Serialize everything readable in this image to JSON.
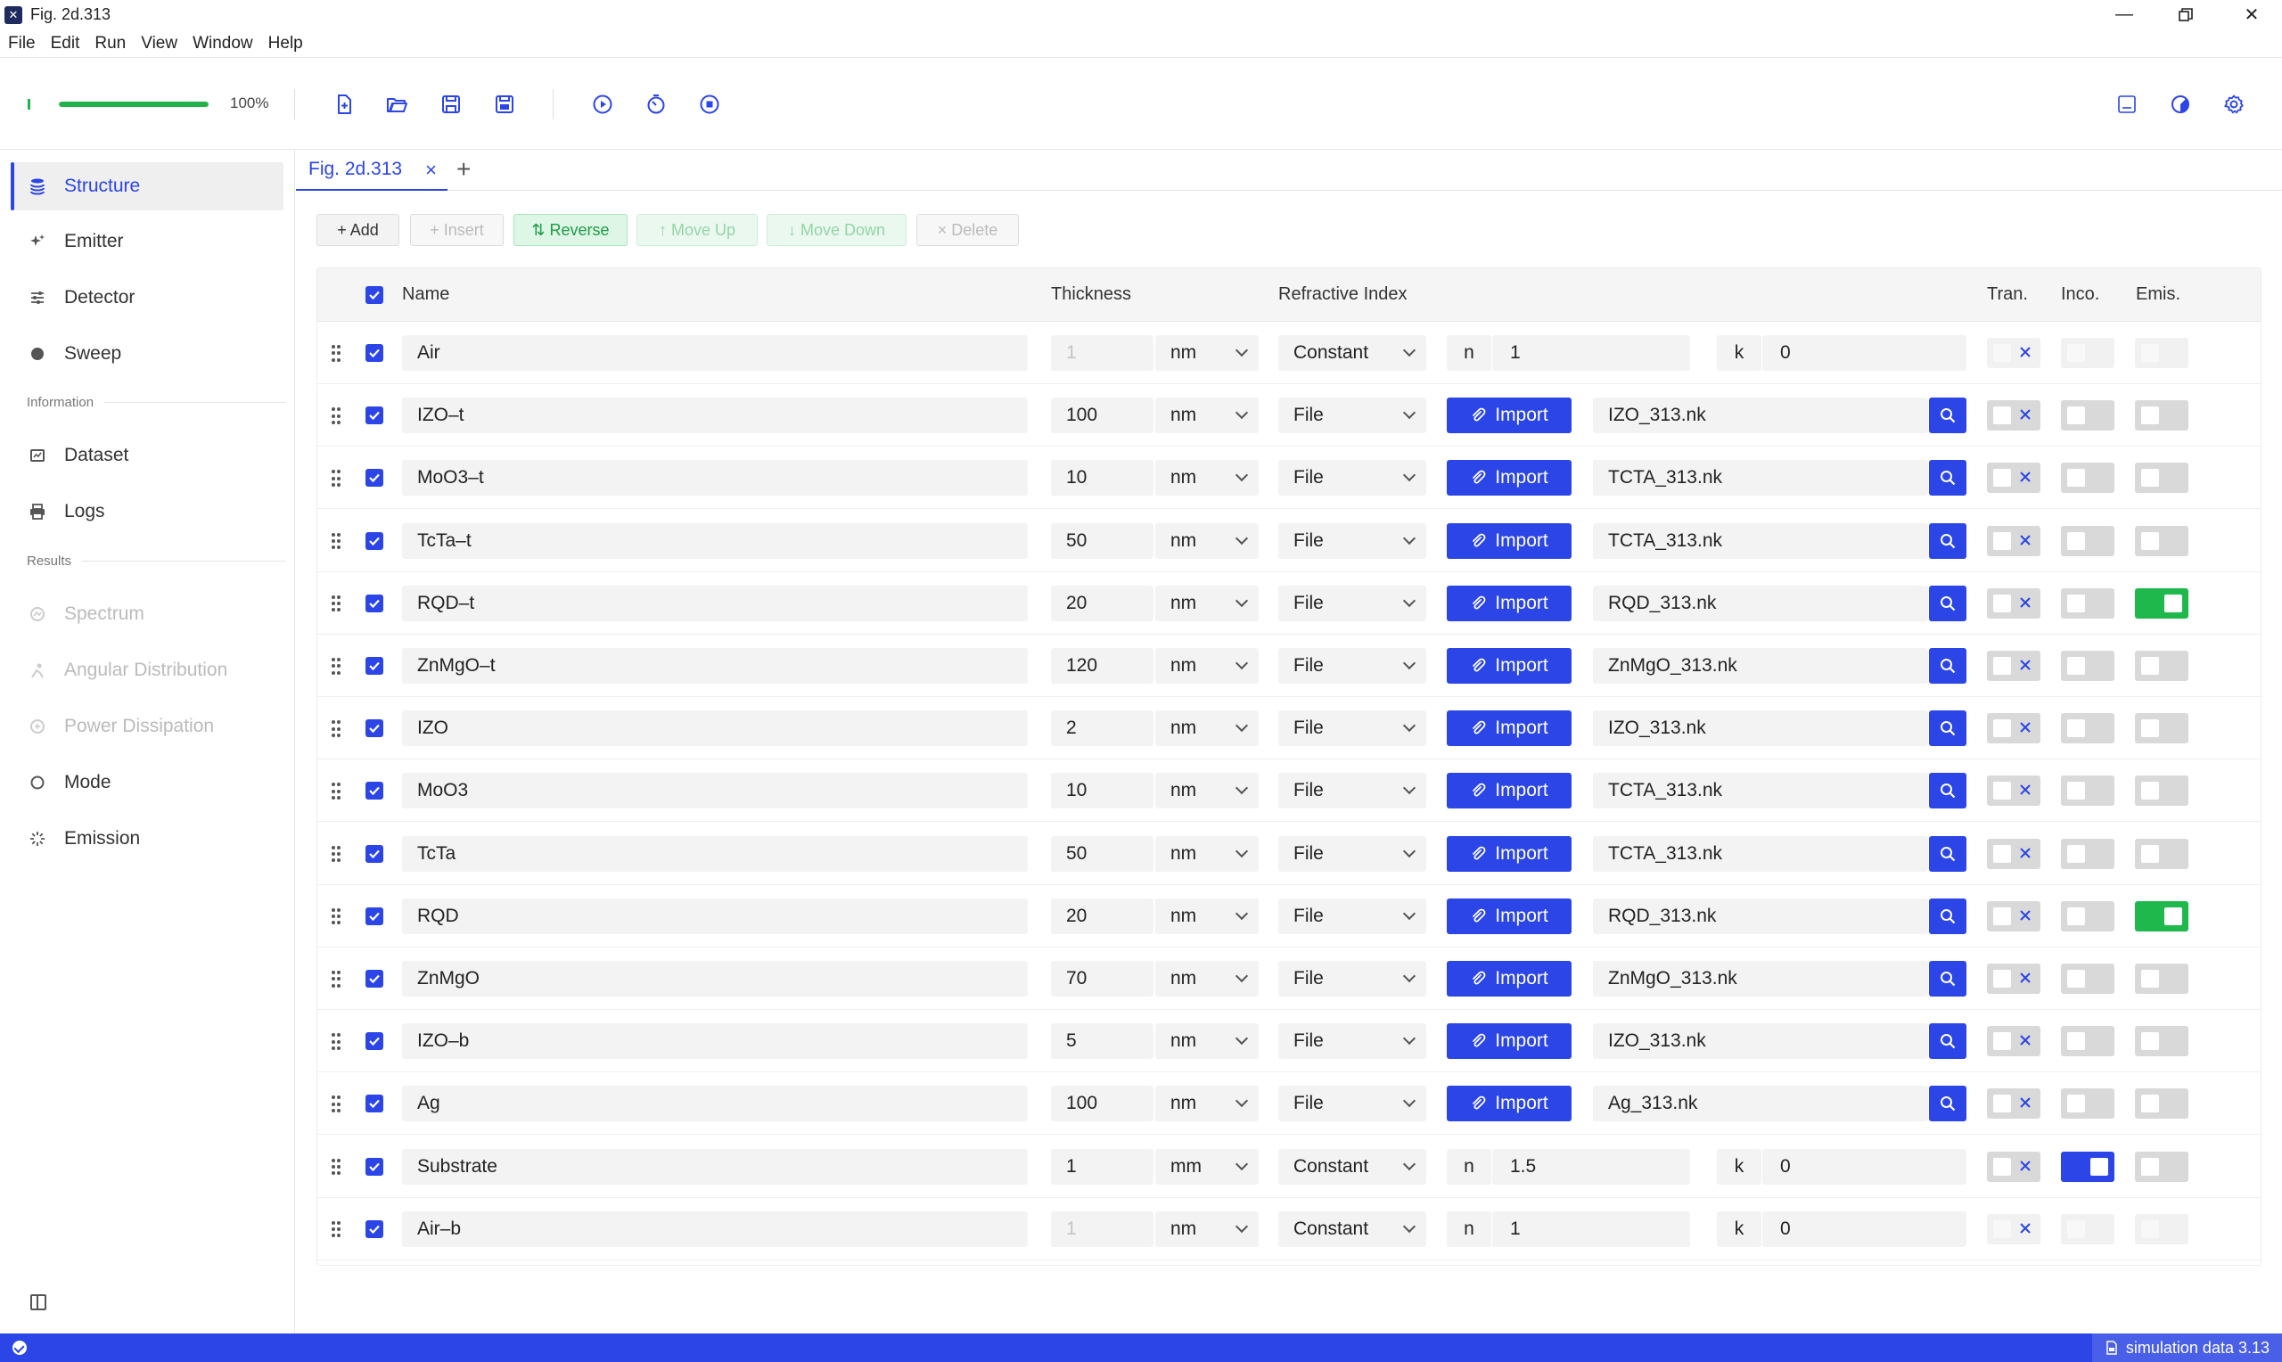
{
  "window": {
    "title": "Fig. 2d.313"
  },
  "menu": [
    "File",
    "Edit",
    "Run",
    "View",
    "Window",
    "Help"
  ],
  "progress": {
    "value": 1.0,
    "label": "100%"
  },
  "sidebar": {
    "items": [
      {
        "label": "Structure",
        "icon": "layers-icon",
        "state": "active"
      },
      {
        "label": "Emitter",
        "icon": "sparkle-icon",
        "state": "normal"
      },
      {
        "label": "Detector",
        "icon": "sliders-icon",
        "state": "normal"
      },
      {
        "label": "Sweep",
        "icon": "circle-icon",
        "state": "normal"
      }
    ],
    "section_information": "Information",
    "info_items": [
      {
        "label": "Dataset",
        "icon": "dataset-icon",
        "state": "normal"
      },
      {
        "label": "Logs",
        "icon": "printer-icon",
        "state": "normal"
      }
    ],
    "section_results": "Results",
    "result_items": [
      {
        "label": "Spectrum",
        "icon": "spectrum-icon",
        "state": "disabled"
      },
      {
        "label": "Angular Distribution",
        "icon": "angular-icon",
        "state": "disabled"
      },
      {
        "label": "Power Dissipation",
        "icon": "power-icon",
        "state": "disabled"
      },
      {
        "label": "Mode",
        "icon": "ring-icon",
        "state": "normal"
      },
      {
        "label": "Emission",
        "icon": "loader-icon",
        "state": "normal"
      }
    ]
  },
  "tab": {
    "label": "Fig. 2d.313",
    "close": "×",
    "add": "+"
  },
  "actions": {
    "add": "+ Add",
    "insert": "+ Insert",
    "reverse": "⇅ Reverse",
    "move_up": "↑ Move Up",
    "move_down": "↓ Move Down",
    "delete": "× Delete"
  },
  "table": {
    "headers": {
      "name": "Name",
      "thickness": "Thickness",
      "refractive_index": "Refractive Index",
      "tran": "Tran.",
      "inco": "Inco.",
      "emis": "Emis."
    },
    "rows": [
      {
        "name": "Air",
        "thickness": "1",
        "unit": "nm",
        "mode": "Constant",
        "n": "1",
        "k": "0",
        "faded": true,
        "tran": "dis",
        "inco": "dis",
        "emis": "dis"
      },
      {
        "name": "IZO–t",
        "thickness": "100",
        "unit": "nm",
        "mode": "File",
        "file": "IZO_313.nk",
        "tran": "off",
        "inco": "off",
        "emis": "off"
      },
      {
        "name": "MoO3–t",
        "thickness": "10",
        "unit": "nm",
        "mode": "File",
        "file": "TCTA_313.nk",
        "tran": "off",
        "inco": "off",
        "emis": "off"
      },
      {
        "name": "TcTa–t",
        "thickness": "50",
        "unit": "nm",
        "mode": "File",
        "file": "TCTA_313.nk",
        "tran": "off",
        "inco": "off",
        "emis": "off"
      },
      {
        "name": "RQD–t",
        "thickness": "20",
        "unit": "nm",
        "mode": "File",
        "file": "RQD_313.nk",
        "tran": "off",
        "inco": "off",
        "emis": "green"
      },
      {
        "name": "ZnMgO–t",
        "thickness": "120",
        "unit": "nm",
        "mode": "File",
        "file": "ZnMgO_313.nk",
        "tran": "off",
        "inco": "off",
        "emis": "off"
      },
      {
        "name": "IZO",
        "thickness": "2",
        "unit": "nm",
        "mode": "File",
        "file": "IZO_313.nk",
        "tran": "off",
        "inco": "off",
        "emis": "off"
      },
      {
        "name": "MoO3",
        "thickness": "10",
        "unit": "nm",
        "mode": "File",
        "file": "TCTA_313.nk",
        "tran": "off",
        "inco": "off",
        "emis": "off"
      },
      {
        "name": "TcTa",
        "thickness": "50",
        "unit": "nm",
        "mode": "File",
        "file": "TCTA_313.nk",
        "tran": "off",
        "inco": "off",
        "emis": "off"
      },
      {
        "name": "RQD",
        "thickness": "20",
        "unit": "nm",
        "mode": "File",
        "file": "RQD_313.nk",
        "tran": "off",
        "inco": "off",
        "emis": "green"
      },
      {
        "name": "ZnMgO",
        "thickness": "70",
        "unit": "nm",
        "mode": "File",
        "file": "ZnMgO_313.nk",
        "tran": "off",
        "inco": "off",
        "emis": "off"
      },
      {
        "name": "IZO–b",
        "thickness": "5",
        "unit": "nm",
        "mode": "File",
        "file": "IZO_313.nk",
        "tran": "off",
        "inco": "off",
        "emis": "off"
      },
      {
        "name": "Ag",
        "thickness": "100",
        "unit": "nm",
        "mode": "File",
        "file": "Ag_313.nk",
        "tran": "off",
        "inco": "off",
        "emis": "off"
      },
      {
        "name": "Substrate",
        "thickness": "1",
        "unit": "mm",
        "mode": "Constant",
        "n": "1.5",
        "k": "0",
        "tran": "off",
        "inco": "blue",
        "emis": "off"
      },
      {
        "name": "Air–b",
        "thickness": "1",
        "unit": "nm",
        "mode": "Constant",
        "n": "1",
        "k": "0",
        "faded": true,
        "tran": "dis",
        "inco": "dis",
        "emis": "dis"
      }
    ],
    "import_label": "Import",
    "n_label": "n",
    "k_label": "k"
  },
  "status": {
    "right": "simulation data 3.13"
  },
  "colors": {
    "accent": "#2b45e6",
    "green": "#1fb84c",
    "status_bar": "#2b45e6"
  }
}
